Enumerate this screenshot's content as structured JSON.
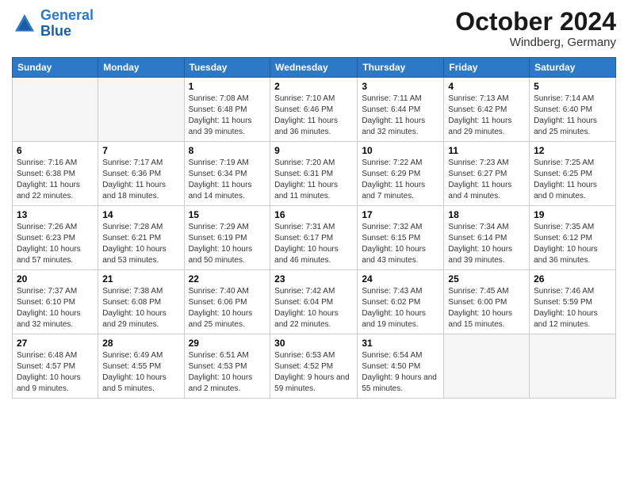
{
  "logo": {
    "line1": "General",
    "line2": "Blue"
  },
  "title": "October 2024",
  "subtitle": "Windberg, Germany",
  "days_of_week": [
    "Sunday",
    "Monday",
    "Tuesday",
    "Wednesday",
    "Thursday",
    "Friday",
    "Saturday"
  ],
  "weeks": [
    [
      {
        "day": "",
        "info": ""
      },
      {
        "day": "",
        "info": ""
      },
      {
        "day": "1",
        "info": "Sunrise: 7:08 AM\nSunset: 6:48 PM\nDaylight: 11 hours and 39 minutes."
      },
      {
        "day": "2",
        "info": "Sunrise: 7:10 AM\nSunset: 6:46 PM\nDaylight: 11 hours and 36 minutes."
      },
      {
        "day": "3",
        "info": "Sunrise: 7:11 AM\nSunset: 6:44 PM\nDaylight: 11 hours and 32 minutes."
      },
      {
        "day": "4",
        "info": "Sunrise: 7:13 AM\nSunset: 6:42 PM\nDaylight: 11 hours and 29 minutes."
      },
      {
        "day": "5",
        "info": "Sunrise: 7:14 AM\nSunset: 6:40 PM\nDaylight: 11 hours and 25 minutes."
      }
    ],
    [
      {
        "day": "6",
        "info": "Sunrise: 7:16 AM\nSunset: 6:38 PM\nDaylight: 11 hours and 22 minutes."
      },
      {
        "day": "7",
        "info": "Sunrise: 7:17 AM\nSunset: 6:36 PM\nDaylight: 11 hours and 18 minutes."
      },
      {
        "day": "8",
        "info": "Sunrise: 7:19 AM\nSunset: 6:34 PM\nDaylight: 11 hours and 14 minutes."
      },
      {
        "day": "9",
        "info": "Sunrise: 7:20 AM\nSunset: 6:31 PM\nDaylight: 11 hours and 11 minutes."
      },
      {
        "day": "10",
        "info": "Sunrise: 7:22 AM\nSunset: 6:29 PM\nDaylight: 11 hours and 7 minutes."
      },
      {
        "day": "11",
        "info": "Sunrise: 7:23 AM\nSunset: 6:27 PM\nDaylight: 11 hours and 4 minutes."
      },
      {
        "day": "12",
        "info": "Sunrise: 7:25 AM\nSunset: 6:25 PM\nDaylight: 11 hours and 0 minutes."
      }
    ],
    [
      {
        "day": "13",
        "info": "Sunrise: 7:26 AM\nSunset: 6:23 PM\nDaylight: 10 hours and 57 minutes."
      },
      {
        "day": "14",
        "info": "Sunrise: 7:28 AM\nSunset: 6:21 PM\nDaylight: 10 hours and 53 minutes."
      },
      {
        "day": "15",
        "info": "Sunrise: 7:29 AM\nSunset: 6:19 PM\nDaylight: 10 hours and 50 minutes."
      },
      {
        "day": "16",
        "info": "Sunrise: 7:31 AM\nSunset: 6:17 PM\nDaylight: 10 hours and 46 minutes."
      },
      {
        "day": "17",
        "info": "Sunrise: 7:32 AM\nSunset: 6:15 PM\nDaylight: 10 hours and 43 minutes."
      },
      {
        "day": "18",
        "info": "Sunrise: 7:34 AM\nSunset: 6:14 PM\nDaylight: 10 hours and 39 minutes."
      },
      {
        "day": "19",
        "info": "Sunrise: 7:35 AM\nSunset: 6:12 PM\nDaylight: 10 hours and 36 minutes."
      }
    ],
    [
      {
        "day": "20",
        "info": "Sunrise: 7:37 AM\nSunset: 6:10 PM\nDaylight: 10 hours and 32 minutes."
      },
      {
        "day": "21",
        "info": "Sunrise: 7:38 AM\nSunset: 6:08 PM\nDaylight: 10 hours and 29 minutes."
      },
      {
        "day": "22",
        "info": "Sunrise: 7:40 AM\nSunset: 6:06 PM\nDaylight: 10 hours and 25 minutes."
      },
      {
        "day": "23",
        "info": "Sunrise: 7:42 AM\nSunset: 6:04 PM\nDaylight: 10 hours and 22 minutes."
      },
      {
        "day": "24",
        "info": "Sunrise: 7:43 AM\nSunset: 6:02 PM\nDaylight: 10 hours and 19 minutes."
      },
      {
        "day": "25",
        "info": "Sunrise: 7:45 AM\nSunset: 6:00 PM\nDaylight: 10 hours and 15 minutes."
      },
      {
        "day": "26",
        "info": "Sunrise: 7:46 AM\nSunset: 5:59 PM\nDaylight: 10 hours and 12 minutes."
      }
    ],
    [
      {
        "day": "27",
        "info": "Sunrise: 6:48 AM\nSunset: 4:57 PM\nDaylight: 10 hours and 9 minutes."
      },
      {
        "day": "28",
        "info": "Sunrise: 6:49 AM\nSunset: 4:55 PM\nDaylight: 10 hours and 5 minutes."
      },
      {
        "day": "29",
        "info": "Sunrise: 6:51 AM\nSunset: 4:53 PM\nDaylight: 10 hours and 2 minutes."
      },
      {
        "day": "30",
        "info": "Sunrise: 6:53 AM\nSunset: 4:52 PM\nDaylight: 9 hours and 59 minutes."
      },
      {
        "day": "31",
        "info": "Sunrise: 6:54 AM\nSunset: 4:50 PM\nDaylight: 9 hours and 55 minutes."
      },
      {
        "day": "",
        "info": ""
      },
      {
        "day": "",
        "info": ""
      }
    ]
  ]
}
